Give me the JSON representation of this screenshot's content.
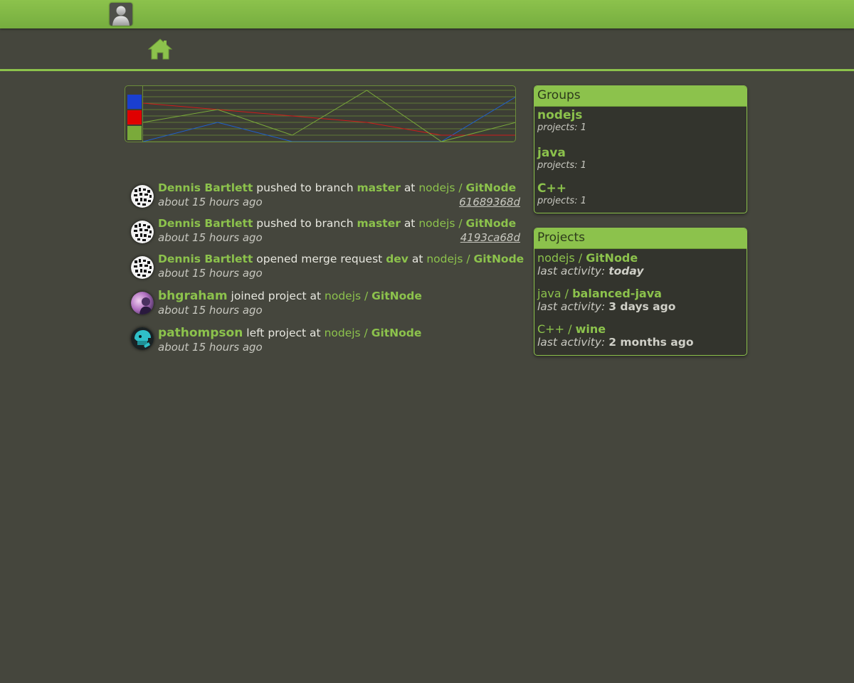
{
  "header": {
    "user_avatar": "user-silhouette-icon",
    "home_icon": "home-icon"
  },
  "colors": {
    "accent": "#8cc24c",
    "background": "#45463d",
    "panel": "#33342d"
  },
  "chart_data": {
    "type": "line",
    "series": [
      {
        "color": "#1e5fd0",
        "values": [
          0,
          3,
          0,
          0,
          0,
          7
        ]
      },
      {
        "color": "#d01a1a",
        "values": [
          6,
          5,
          4,
          3,
          1,
          1
        ]
      },
      {
        "color": "#7aaa3a",
        "values": [
          3,
          5,
          1,
          8,
          0,
          3
        ]
      }
    ],
    "legend_colors": [
      "#1a3fd0",
      "#e00000",
      "#7aaa3a"
    ],
    "grid": true
  },
  "feed": [
    {
      "user": "Dennis Bartlett",
      "action": "pushed to branch",
      "ref": "master",
      "at": "at",
      "namespace": "nodejs /",
      "project": "GitNode",
      "time": "about 15 hours ago",
      "commit": "61689368d"
    },
    {
      "user": "Dennis Bartlett",
      "action": "pushed to branch",
      "ref": "master",
      "at": "at",
      "namespace": "nodejs /",
      "project": "GitNode",
      "time": "about 15 hours ago",
      "commit": "4193ca68d"
    },
    {
      "user": "Dennis Bartlett",
      "action": "opened merge request",
      "ref": "dev",
      "at": "at",
      "namespace": "nodejs /",
      "project": "GitNode",
      "time": "about 15 hours ago"
    },
    {
      "user": "bhgraham",
      "action": "joined project",
      "at": "at",
      "namespace": "nodejs /",
      "project": "GitNode",
      "time": "about 15 hours ago"
    },
    {
      "user": "pathompson",
      "action": "left project",
      "at": "at",
      "namespace": "nodejs /",
      "project": "GitNode",
      "time": "about 15 hours ago"
    }
  ],
  "groups": {
    "title": "Groups",
    "items": [
      {
        "name": "nodejs",
        "meta": "projects: 1"
      },
      {
        "name": "java",
        "meta": "projects: 1"
      },
      {
        "name": "C++",
        "meta": "projects: 1"
      }
    ]
  },
  "projects": {
    "title": "Projects",
    "items": [
      {
        "namespace": "nodejs /",
        "name": "GitNode",
        "label": "last activity:",
        "value": "today"
      },
      {
        "namespace": "java /",
        "name": "balanced-java",
        "label": "last activity:",
        "value": "3 days ago"
      },
      {
        "namespace": "C++ /",
        "name": "wine",
        "label": "last activity:",
        "value": "2 months ago"
      }
    ]
  }
}
